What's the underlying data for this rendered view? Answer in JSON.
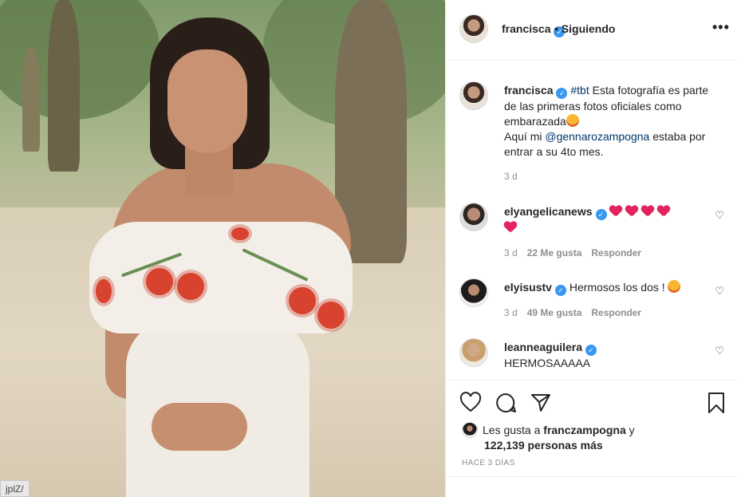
{
  "post": {
    "username": "francisca",
    "follow_status": "• Siguiendo",
    "more": "•••"
  },
  "caption": {
    "username": "francisca",
    "hashtag": "#tbt",
    "text1": " Esta fotografía es parte de las primeras fotos oficiales como embarazada",
    "text2": "Aquí mi ",
    "mention": "@gennarozampogna",
    "text3": " estaba por entrar a su 4to mes.",
    "time": "3 d"
  },
  "comments": [
    {
      "username": "elyangelicanews",
      "text": "",
      "hearts": 5,
      "time": "3 d",
      "likes": "22 Me gusta",
      "reply": "Responder"
    },
    {
      "username": "elyisustv",
      "text": "Hermosos los dos !",
      "time": "3 d",
      "likes": "49 Me gusta",
      "reply": "Responder"
    },
    {
      "username": "leanneaguilera",
      "text": "HERMOSAAAAA"
    }
  ],
  "likes_info": {
    "prefix": "Les gusta a ",
    "user": "franczampogna",
    "mid": " y",
    "count": "122,139 personas más"
  },
  "ago": "HACE 3 DÍAS",
  "url_fragment": "jplZ/",
  "icons": [
    "like-icon",
    "comment-icon",
    "share-icon",
    "save-icon",
    "verified-icon",
    "heart-icon"
  ],
  "colors": {
    "verified": "#3897f0",
    "link": "#00376b",
    "muted": "#8e8e8e",
    "heart": "#e0245e"
  }
}
